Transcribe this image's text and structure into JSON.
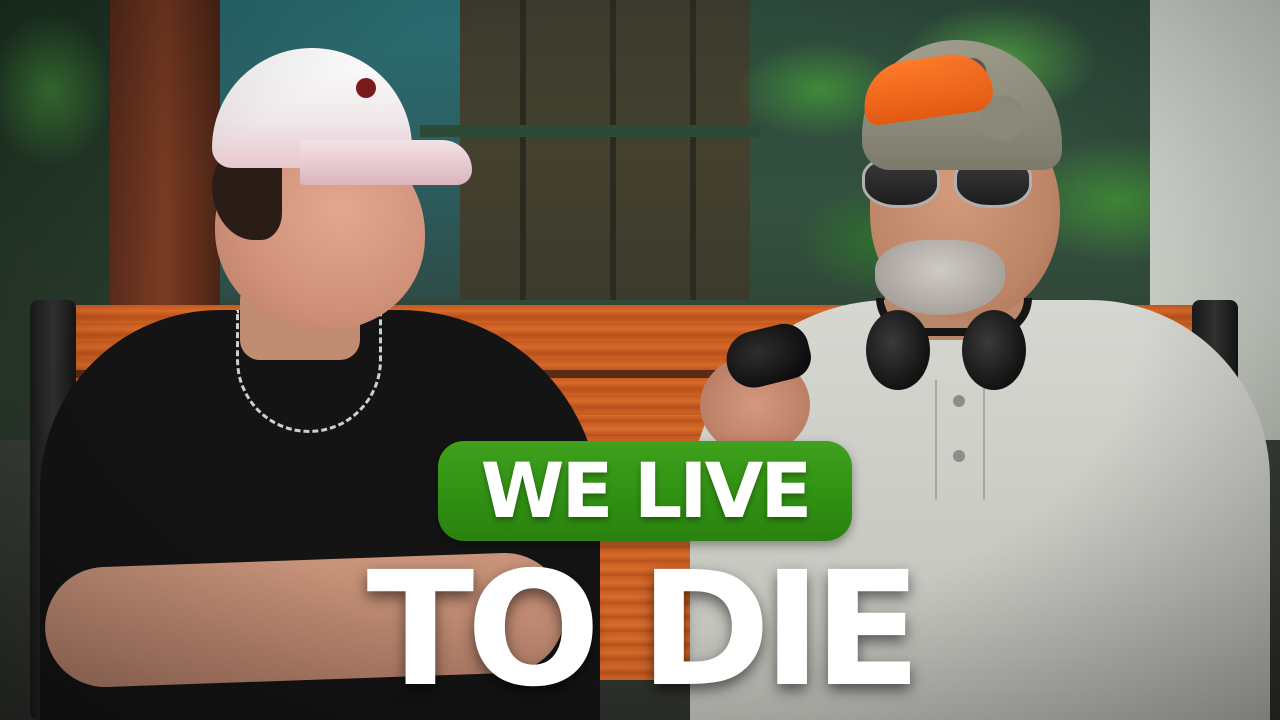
{
  "thumbnail": {
    "headline_top": "WE LIVE",
    "headline_bottom": "TO DIE",
    "accent_color": "#2f8f12",
    "text_color": "#ffffff"
  }
}
